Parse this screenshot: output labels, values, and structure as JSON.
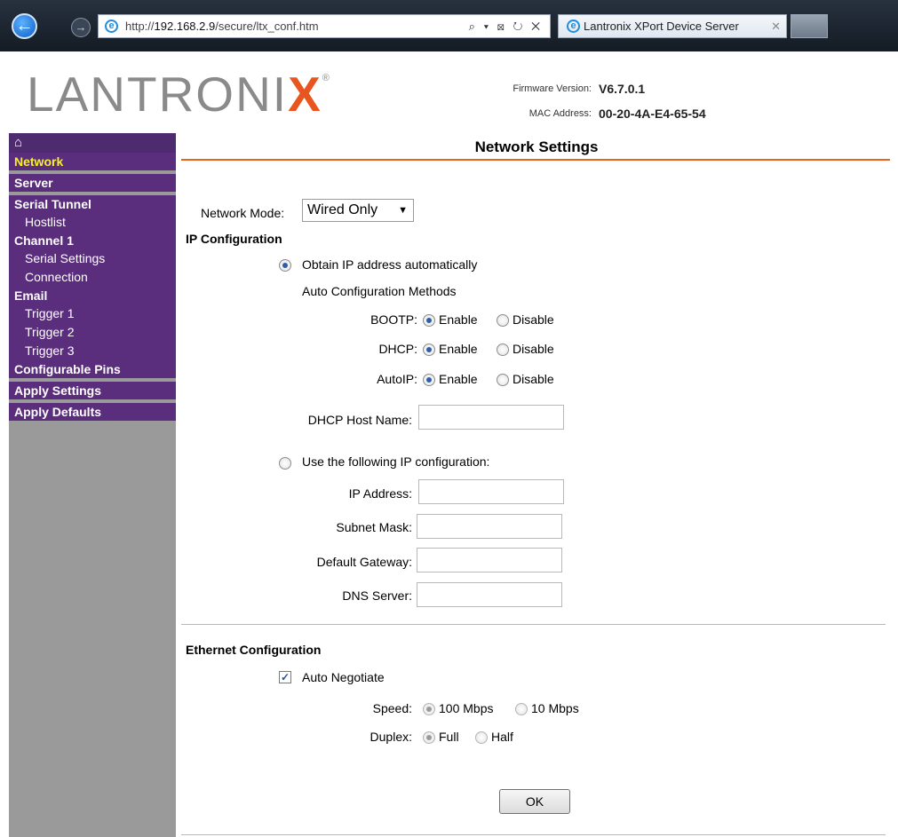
{
  "browser": {
    "url_prefix": "http://",
    "url_host": "192.168.2.9",
    "url_path": "/secure/ltx_conf.htm",
    "address_tools": "⌕ ▾ ⊠ ↻ ✕",
    "tab_title": "Lantronix XPort Device Server",
    "tab_close": "✕",
    "back_glyph": "←",
    "forward_glyph": "→"
  },
  "header": {
    "logo_text_a": "LANTRONI",
    "logo_text_x": "X",
    "logo_reg": "®",
    "firmware_label": "Firmware Version:",
    "firmware_value": "V6.7.0.1",
    "mac_label": "MAC Address:",
    "mac_value": "00-20-4A-E4-65-54"
  },
  "sidebar": {
    "home_icon": "⌂",
    "items": {
      "network": "Network",
      "server": "Server",
      "serial_tunnel": "Serial Tunnel",
      "hostlist": "Hostlist",
      "channel1": "Channel 1",
      "serial_settings": "Serial Settings",
      "connection": "Connection",
      "email": "Email",
      "trigger1": "Trigger 1",
      "trigger2": "Trigger 2",
      "trigger3": "Trigger 3",
      "configurable_pins": "Configurable Pins",
      "apply_settings": "Apply Settings",
      "apply_defaults": "Apply Defaults"
    },
    "active": "network"
  },
  "main": {
    "title": "Network Settings",
    "network_mode_label": "Network Mode:",
    "network_mode_value": "Wired Only",
    "ip_config_heading": "IP Configuration",
    "obtain_auto_label": "Obtain IP address automatically",
    "auto_methods_label": "Auto Configuration Methods",
    "bootp_label": "BOOTP:",
    "dhcp_label": "DHCP:",
    "autoip_label": "AutoIP:",
    "enable_label": "Enable",
    "disable_label": "Disable",
    "dhcp_host_label": "DHCP Host Name:",
    "dhcp_host_value": "",
    "use_following_label": "Use the following IP configuration:",
    "ip_address_label": "IP Address:",
    "ip_address_value": "",
    "subnet_label": "Subnet Mask:",
    "subnet_value": "",
    "gateway_label": "Default Gateway:",
    "gateway_value": "",
    "dns_label": "DNS Server:",
    "dns_value": "",
    "ethernet_heading": "Ethernet Configuration",
    "auto_negotiate_label": "Auto Negotiate",
    "auto_negotiate_checked": true,
    "speed_label": "Speed:",
    "speed_100": "100 Mbps",
    "speed_10": "10 Mbps",
    "duplex_label": "Duplex:",
    "duplex_full": "Full",
    "duplex_half": "Half",
    "ok_label": "OK"
  }
}
